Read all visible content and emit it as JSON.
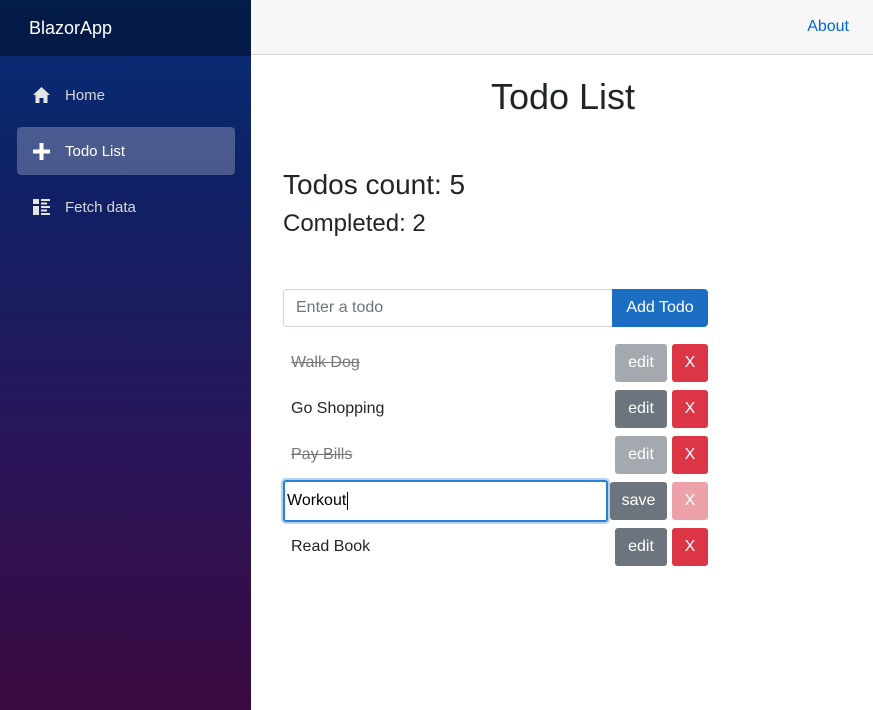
{
  "brand": "BlazorApp",
  "nav": [
    {
      "label": "Home",
      "icon": "home-icon",
      "active": false
    },
    {
      "label": "Todo List",
      "icon": "plus-icon",
      "active": true
    },
    {
      "label": "Fetch data",
      "icon": "list-rich-icon",
      "active": false
    }
  ],
  "top_row": {
    "about_label": "About"
  },
  "page": {
    "title": "Todo List",
    "count_text": "Todos count: 5",
    "completed_text": "Completed: 2"
  },
  "add_form": {
    "placeholder": "Enter a todo",
    "button_label": "Add Todo"
  },
  "todos": [
    {
      "title": "Walk Dog",
      "done": true,
      "editing": false,
      "edit_label": "edit",
      "delete_label": "X"
    },
    {
      "title": "Go Shopping",
      "done": false,
      "editing": false,
      "edit_label": "edit",
      "delete_label": "X"
    },
    {
      "title": "Pay Bills",
      "done": true,
      "editing": false,
      "edit_label": "edit",
      "delete_label": "X"
    },
    {
      "title": "Workout",
      "done": false,
      "editing": true,
      "edit_label": "save",
      "delete_label": "X"
    },
    {
      "title": "Read Book",
      "done": false,
      "editing": false,
      "edit_label": "edit",
      "delete_label": "X"
    }
  ],
  "colors": {
    "primary": "#1b6ec2",
    "danger": "#dc3545",
    "secondary": "#6c757d",
    "link": "#0366d6"
  }
}
